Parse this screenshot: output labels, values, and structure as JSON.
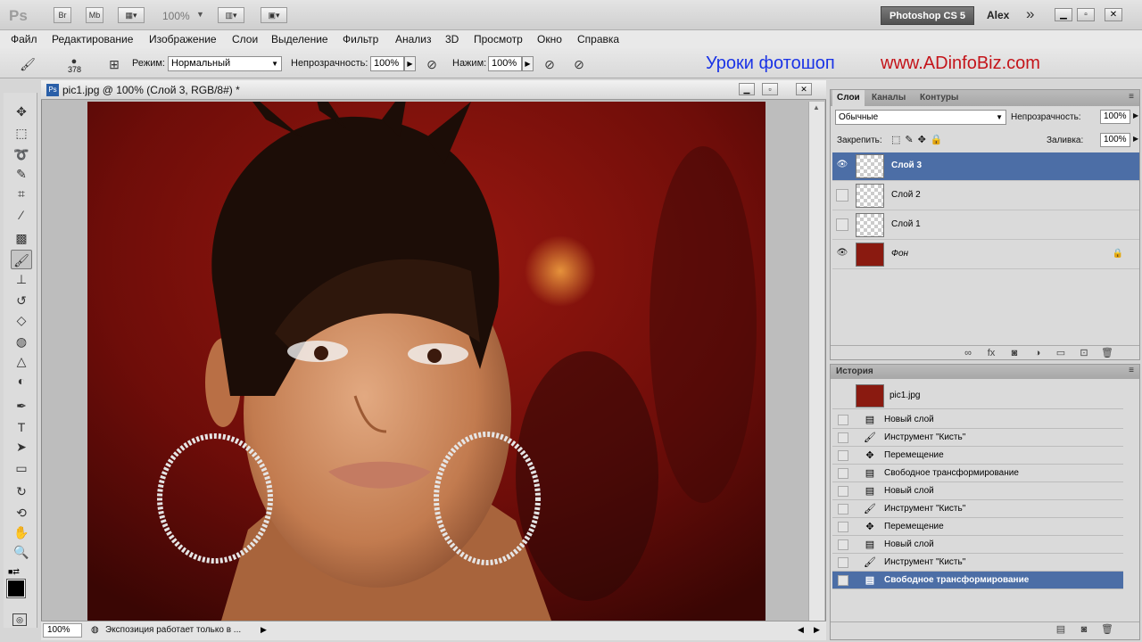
{
  "app": {
    "logo": "Ps",
    "bridge": "Br",
    "minibridge": "Mb",
    "zoom": "100%",
    "workspace": "Photoshop CS 5",
    "user": "Alex",
    "more": "»"
  },
  "menu": [
    "Файл",
    "Редактирование",
    "Изображение",
    "Слои",
    "Выделение",
    "Фильтр",
    "Анализ",
    "3D",
    "Просмотр",
    "Окно",
    "Справка"
  ],
  "options": {
    "brush_size": "378",
    "mode_label": "Режим:",
    "mode_value": "Нормальный",
    "opacity_label": "Непрозрачность:",
    "opacity_value": "100%",
    "flow_label": "Нажим:",
    "flow_value": "100%"
  },
  "promo": {
    "left": "Уроки фотошоп",
    "right": "www.ADinfoBiz.com"
  },
  "document": {
    "title": "pic1.jpg @ 100% (Слой 3, RGB/8#) *"
  },
  "status": {
    "zoom": "100%",
    "message": "Экспозиция работает только в ..."
  },
  "layers_panel": {
    "tabs": [
      "Слои",
      "Каналы",
      "Контуры"
    ],
    "blend": "Обычные",
    "opacity_label": "Непрозрачность:",
    "opacity_value": "100%",
    "lock_label": "Закрепить:",
    "fill_label": "Заливка:",
    "fill_value": "100%",
    "layers": [
      {
        "name": "Слой 3",
        "visible": true,
        "active": true
      },
      {
        "name": "Слой 2",
        "visible": false,
        "active": false
      },
      {
        "name": "Слой 1",
        "visible": false,
        "active": false
      },
      {
        "name": "Фон",
        "visible": true,
        "active": false,
        "locked": true
      }
    ]
  },
  "history_panel": {
    "tab": "История",
    "snapshot": "pic1.jpg",
    "items": [
      {
        "icon": "new-layer-icon",
        "label": "Новый слой"
      },
      {
        "icon": "brush-icon",
        "label": "Инструмент \"Кисть\""
      },
      {
        "icon": "move-icon",
        "label": "Перемещение"
      },
      {
        "icon": "transform-icon",
        "label": "Свободное трансформирование"
      },
      {
        "icon": "new-layer-icon",
        "label": "Новый слой"
      },
      {
        "icon": "brush-icon",
        "label": "Инструмент \"Кисть\""
      },
      {
        "icon": "move-icon",
        "label": "Перемещение"
      },
      {
        "icon": "new-layer-icon",
        "label": "Новый слой"
      },
      {
        "icon": "brush-icon",
        "label": "Инструмент \"Кисть\""
      },
      {
        "icon": "transform-icon",
        "label": "Свободное трансформирование",
        "active": true
      }
    ]
  },
  "colors": {
    "accent": "#4c6ea6",
    "promo_blue": "#1a33e6",
    "promo_red": "#c4141a",
    "canvas_bg": "#7a0f0c"
  }
}
